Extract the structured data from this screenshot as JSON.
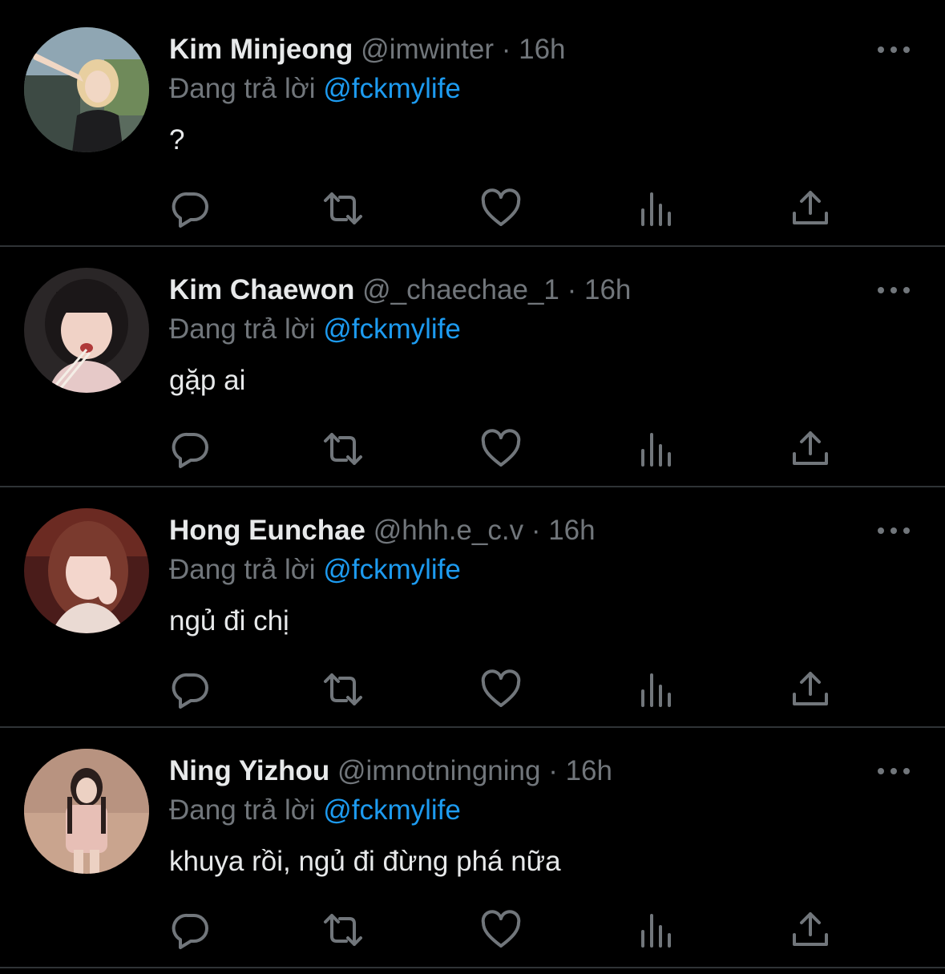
{
  "colors": {
    "background": "#000000",
    "name_text": "#e7e9ea",
    "secondary_text": "#71767b",
    "accent_link": "#1d9bf0",
    "divider": "#2f3336"
  },
  "icons": {
    "reply": "speech-bubble-icon",
    "retweet": "retweet-arrows-icon",
    "like": "heart-icon",
    "views": "bar-chart-icon",
    "share": "share-upload-icon",
    "more": "more-dots-icon"
  },
  "tweets": [
    {
      "name": "Kim Minjeong",
      "handle": "@imwinter",
      "separator": "·",
      "time": "16h",
      "reply_prefix": "Đang trả lời",
      "reply_to": "@fckmylife",
      "text": "?"
    },
    {
      "name": "Kim Chaewon",
      "handle": "@_chaechae_1",
      "separator": "·",
      "time": "16h",
      "reply_prefix": "Đang trả lời",
      "reply_to": "@fckmylife",
      "text": "gặp ai"
    },
    {
      "name": "Hong Eunchae",
      "handle": "@hhh.e_c.v",
      "separator": "·",
      "time": "16h",
      "reply_prefix": "Đang trả lời",
      "reply_to": "@fckmylife",
      "text": "ngủ đi chị"
    },
    {
      "name": "Ning Yizhou",
      "handle": "@imnotningning",
      "separator": "·",
      "time": "16h",
      "reply_prefix": "Đang trả lời",
      "reply_to": "@fckmylife",
      "text": "khuya rồi, ngủ đi đừng phá nữa"
    }
  ]
}
